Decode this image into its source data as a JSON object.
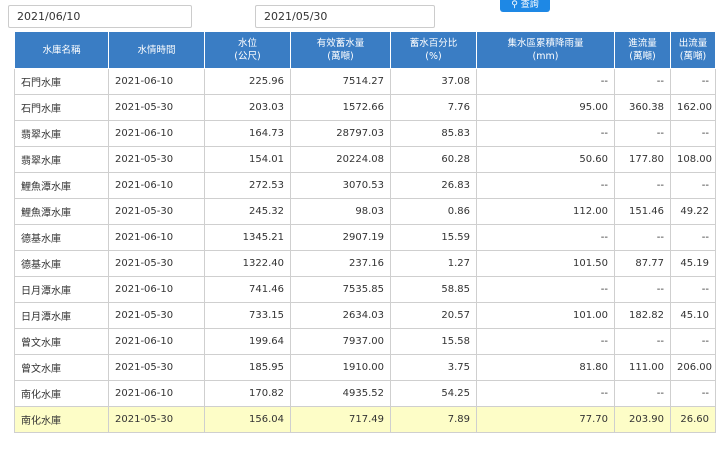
{
  "filters": {
    "start_date": "2021/06/10",
    "end_date": "2021/05/30",
    "search_label": "查詢"
  },
  "table": {
    "headers": [
      [
        "水庫名稱"
      ],
      [
        "水情時間"
      ],
      [
        "水位",
        "(公尺)"
      ],
      [
        "有效蓄水量",
        "(萬噸)"
      ],
      [
        "蓄水百分比",
        "(%)"
      ],
      [
        "集水區累積降雨量",
        "(mm)"
      ],
      [
        "進流量",
        "(萬噸)"
      ],
      [
        "出流量",
        "(萬噸)"
      ]
    ],
    "rows": [
      [
        "石門水庫",
        "2021-06-10",
        "225.96",
        "7514.27",
        "37.08",
        "--",
        "--",
        "--"
      ],
      [
        "石門水庫",
        "2021-05-30",
        "203.03",
        "1572.66",
        "7.76",
        "95.00",
        "360.38",
        "162.00"
      ],
      [
        "翡翠水庫",
        "2021-06-10",
        "164.73",
        "28797.03",
        "85.83",
        "--",
        "--",
        "--"
      ],
      [
        "翡翠水庫",
        "2021-05-30",
        "154.01",
        "20224.08",
        "60.28",
        "50.60",
        "177.80",
        "108.00"
      ],
      [
        "鯉魚潭水庫",
        "2021-06-10",
        "272.53",
        "3070.53",
        "26.83",
        "--",
        "--",
        "--"
      ],
      [
        "鯉魚潭水庫",
        "2021-05-30",
        "245.32",
        "98.03",
        "0.86",
        "112.00",
        "151.46",
        "49.22"
      ],
      [
        "德基水庫",
        "2021-06-10",
        "1345.21",
        "2907.19",
        "15.59",
        "--",
        "--",
        "--"
      ],
      [
        "德基水庫",
        "2021-05-30",
        "1322.40",
        "237.16",
        "1.27",
        "101.50",
        "87.77",
        "45.19"
      ],
      [
        "日月潭水庫",
        "2021-06-10",
        "741.46",
        "7535.85",
        "58.85",
        "--",
        "--",
        "--"
      ],
      [
        "日月潭水庫",
        "2021-05-30",
        "733.15",
        "2634.03",
        "20.57",
        "101.00",
        "182.82",
        "45.10"
      ],
      [
        "曾文水庫",
        "2021-06-10",
        "199.64",
        "7937.00",
        "15.58",
        "--",
        "--",
        "--"
      ],
      [
        "曾文水庫",
        "2021-05-30",
        "185.95",
        "1910.00",
        "3.75",
        "81.80",
        "111.00",
        "206.00"
      ],
      [
        "南化水庫",
        "2021-06-10",
        "170.82",
        "4935.52",
        "54.25",
        "--",
        "--",
        "--"
      ],
      [
        "南化水庫",
        "2021-05-30",
        "156.04",
        "717.49",
        "7.89",
        "77.70",
        "203.90",
        "26.60"
      ]
    ],
    "highlight_row_index": 13,
    "colors": {
      "header_bg": "#3a7dc4",
      "highlight_bg": "#fdfdc7",
      "button_bg": "#1e88e5"
    }
  }
}
